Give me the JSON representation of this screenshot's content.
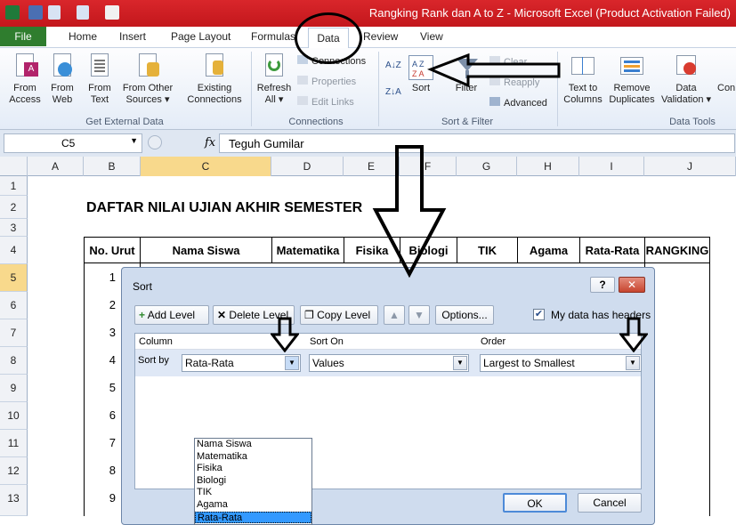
{
  "window": {
    "title": "Rangking Rank dan A to Z  -  Microsoft Excel (Product Activation Failed)"
  },
  "tabs": [
    {
      "label": "File"
    },
    {
      "label": "Home"
    },
    {
      "label": "Insert"
    },
    {
      "label": "Page Layout"
    },
    {
      "label": "Formulas"
    },
    {
      "label": "Data"
    },
    {
      "label": "Review"
    },
    {
      "label": "View"
    }
  ],
  "ribbon": {
    "get_external": {
      "group": "Get External Data",
      "buttons": [
        {
          "line1": "From",
          "line2": "Access"
        },
        {
          "line1": "From",
          "line2": "Web"
        },
        {
          "line1": "From",
          "line2": "Text"
        },
        {
          "line1": "From Other",
          "line2": "Sources ▾"
        },
        {
          "line1": "Existing",
          "line2": "Connections"
        }
      ]
    },
    "connections": {
      "group": "Connections",
      "refresh": {
        "line1": "Refresh",
        "line2": "All ▾"
      },
      "items": [
        "Connections",
        "Properties",
        "Edit Links"
      ]
    },
    "sort_filter": {
      "group": "Sort & Filter",
      "sort": "Sort",
      "filter": "Filter",
      "clear": "Clear",
      "reapply": "Reapply",
      "advanced": "Advanced"
    },
    "data_tools": {
      "group": "Data Tools",
      "buttons": [
        {
          "line1": "Text to",
          "line2": "Columns"
        },
        {
          "line1": "Remove",
          "line2": "Duplicates"
        },
        {
          "line1": "Data",
          "line2": "Validation ▾"
        },
        {
          "line1": "Con",
          "line2": ""
        }
      ]
    }
  },
  "formula_bar": {
    "name_box": "C5",
    "fx": "fx",
    "value": "Teguh Gumilar"
  },
  "grid": {
    "columns": [
      "A",
      "B",
      "C",
      "D",
      "E",
      "F",
      "G",
      "H",
      "I",
      "J"
    ],
    "rows": [
      "1",
      "2",
      "3",
      "4",
      "5",
      "6",
      "7",
      "8",
      "9",
      "10",
      "11",
      "12",
      "13"
    ],
    "sheet_title": "DAFTAR NILAI UJIAN AKHIR SEMESTER",
    "headers": [
      "No. Urut",
      "Nama Siswa",
      "Matematika",
      "Fisika",
      "Biologi",
      "TIK",
      "Agama",
      "Rata-Rata",
      "RANGKING"
    ],
    "numbers": [
      "1",
      "2",
      "3",
      "4",
      "5",
      "6",
      "7",
      "8",
      "9"
    ]
  },
  "dialog": {
    "title": "Sort",
    "help": "?",
    "close": "✕",
    "add_level": "Add Level",
    "delete_level": "Delete Level",
    "copy_level": "Copy Level",
    "options": "Options...",
    "headers_checkbox": "My data has headers",
    "col_header": "Column",
    "sort_on_header": "Sort On",
    "order_header": "Order",
    "sort_by_label": "Sort by",
    "sort_by_value": "Rata-Rata",
    "sort_on_value": "Values",
    "order_value": "Largest to Smallest",
    "dropdown_options": [
      "Nama Siswa",
      "Matematika",
      "Fisika",
      "Biologi",
      "TIK",
      "Agama",
      "Rata-Rata"
    ],
    "ok": "OK",
    "cancel": "Cancel"
  }
}
